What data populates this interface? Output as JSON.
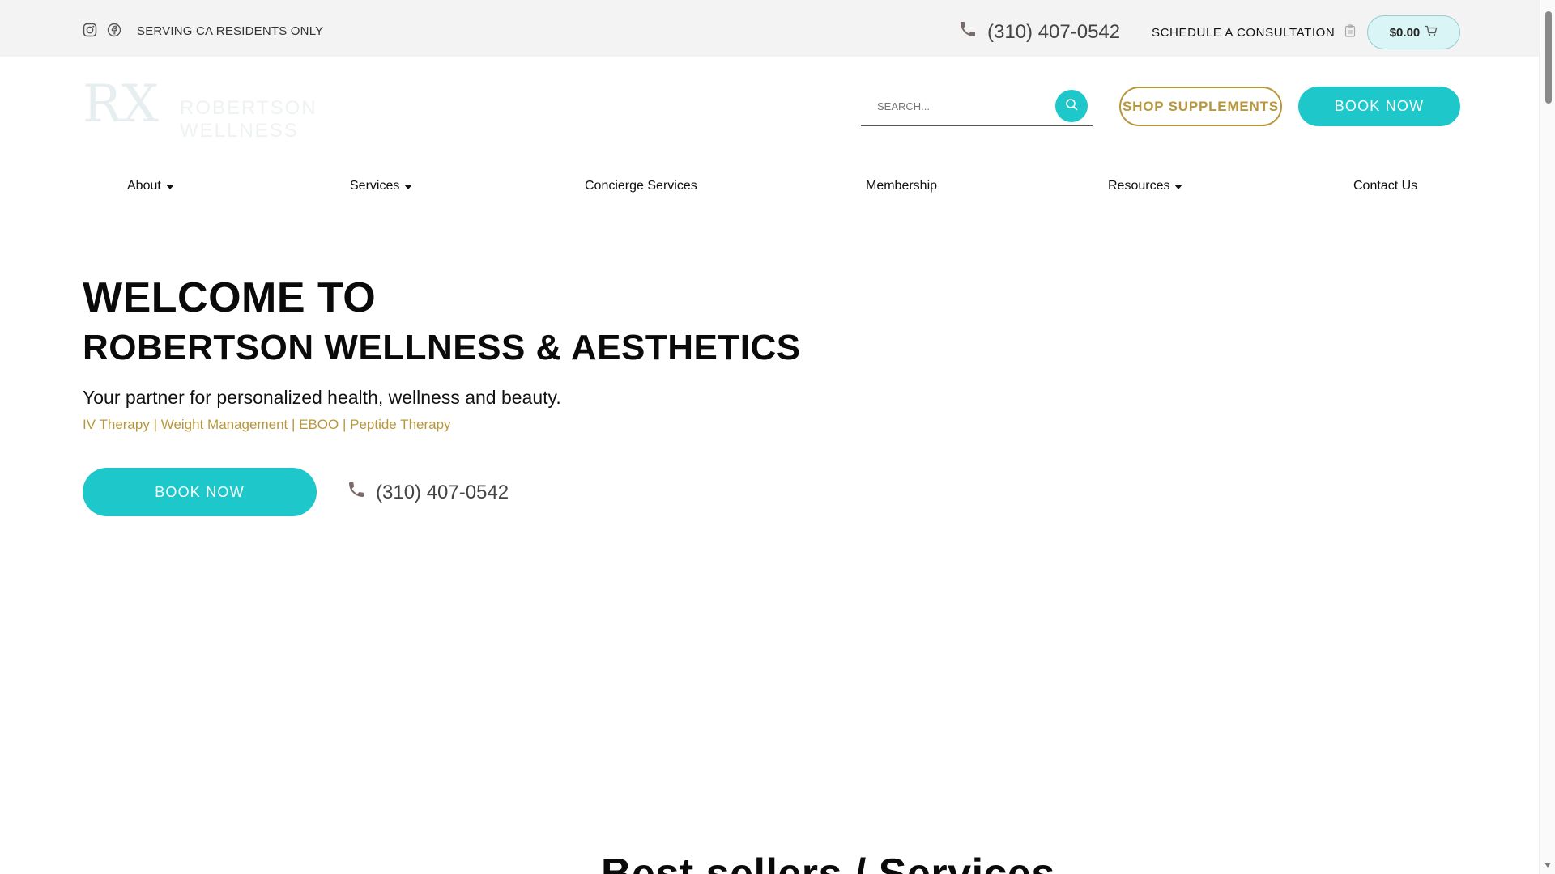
{
  "topbar": {
    "social_icons": [
      "instagram-icon",
      "facebook-icon"
    ],
    "serving_text": "SERVING CA RESIDENTS ONLY",
    "phone": "(310) 407-0542",
    "schedule_label": "SCHEDULE A CONSULTATION",
    "cart_total": "$0.00"
  },
  "header": {
    "logo_mark": "RX",
    "logo_text": "ROBERTSON WELLNESS",
    "search_placeholder": "SEARCH...",
    "shop_label": "SHOP SUPPLEMENTS",
    "book_label": "BOOK NOW"
  },
  "nav": {
    "items": [
      {
        "label": "About",
        "has_dropdown": true
      },
      {
        "label": "Services",
        "has_dropdown": true
      },
      {
        "label": "Concierge Services",
        "has_dropdown": false
      },
      {
        "label": "Membership",
        "has_dropdown": false
      },
      {
        "label": "Resources",
        "has_dropdown": true
      },
      {
        "label": "Contact Us",
        "has_dropdown": false
      }
    ]
  },
  "hero": {
    "welcome": "WELCOME TO",
    "name": "ROBERTSON WELLNESS & AESTHETICS",
    "tagline": "Your partner for personalized health, wellness and beauty.",
    "services_line": "IV Therapy | Weight Management | EBOO | Peptide Therapy",
    "book_label": "BOOK NOW",
    "phone": "(310) 407-0542"
  },
  "section": {
    "title": "Best sellers / Services"
  },
  "colors": {
    "accent": "#1ec7c9",
    "gold": "#b8973c",
    "topbar_bg": "#f3f3f3"
  }
}
